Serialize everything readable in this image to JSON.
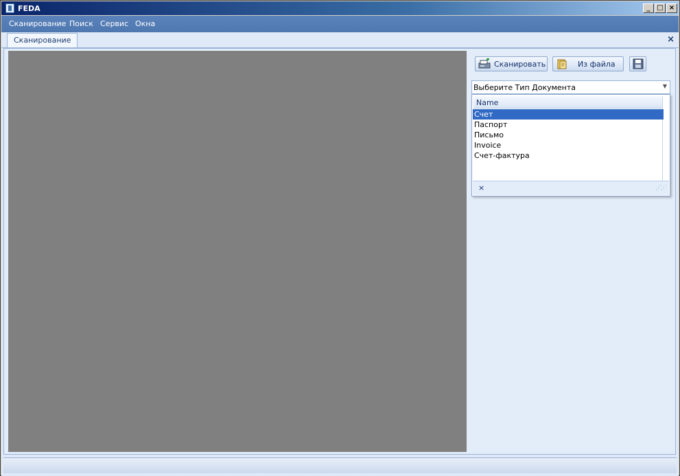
{
  "window": {
    "title": "FEDA",
    "min": "_",
    "max": "□",
    "close": "×"
  },
  "menu": [
    {
      "label": "Сканирование"
    },
    {
      "label": "Поиск"
    },
    {
      "label": "Сервис"
    },
    {
      "label": "Окна"
    }
  ],
  "tabs": [
    {
      "label": "Сканирование"
    }
  ],
  "tab_close": "×",
  "toolbar": {
    "scan_label": "Сканировать",
    "file_label": "Из файла",
    "save_icon": "save-icon"
  },
  "doc_type": {
    "value": "Выберите Тип Документа",
    "column": "Name",
    "options": [
      "Счет",
      "Паспорт",
      "Письмо",
      "Invoice",
      "Счет-фактура"
    ],
    "selected_index": 0,
    "clear": "×"
  },
  "colors": {
    "menubar": "#4f78b0",
    "selection": "#316ac5",
    "preview": "#808080"
  }
}
